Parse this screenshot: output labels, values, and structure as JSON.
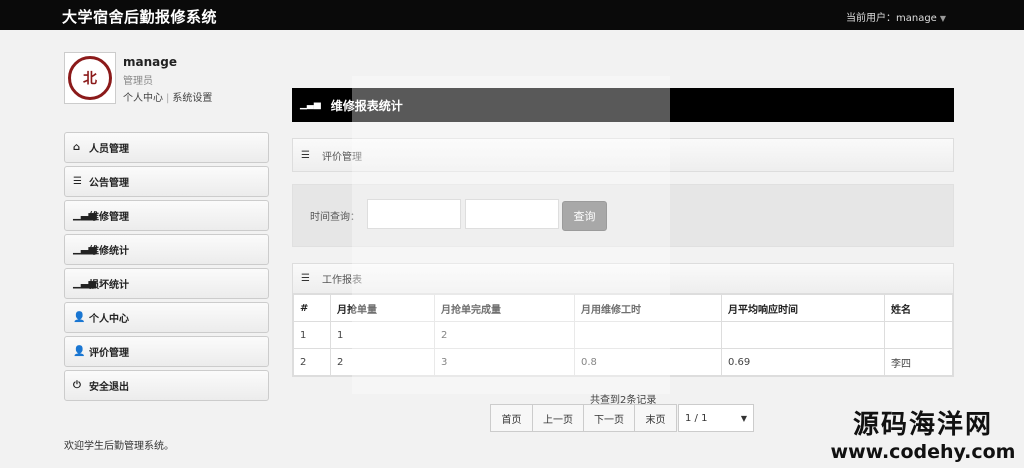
{
  "app": {
    "title": "大学宿舍后勤报修系统",
    "current_user_label": "当前用户：manage"
  },
  "profile": {
    "username": "manage",
    "role": "管理员",
    "link_center": "个人中心",
    "link_settings": "系统设置",
    "avatar_icon": "university-seal-icon"
  },
  "sidebar": {
    "items": [
      {
        "label": "人员管理",
        "icon": "home-icon"
      },
      {
        "label": "公告管理",
        "icon": "list-icon"
      },
      {
        "label": "维修管理",
        "icon": "signal-icon"
      },
      {
        "label": "维修统计",
        "icon": "signal-icon"
      },
      {
        "label": "损坏统计",
        "icon": "signal-icon"
      },
      {
        "label": "个人中心",
        "icon": "user-icon"
      },
      {
        "label": "评价管理",
        "icon": "user-icon"
      },
      {
        "label": "安全退出",
        "icon": "power-icon"
      }
    ],
    "welcome": "欢迎学生后勤管理系统。"
  },
  "main": {
    "panel_title": "维修报表统计",
    "eval_panel_title": "评价管理",
    "query": {
      "label": "时间查询：",
      "start_value": "",
      "end_value": "",
      "button": "查询"
    },
    "report": {
      "title": "工作报表",
      "columns": [
        "#",
        "月抢单量",
        "月抢单完成量",
        "月用维修工时",
        "月平均响应时间",
        "姓名"
      ],
      "rows": [
        [
          "1",
          "1",
          "2",
          "",
          "",
          ""
        ],
        [
          "2",
          "2",
          "3",
          "0.8",
          "0.69",
          "李四"
        ]
      ]
    },
    "pager": {
      "count": "共查到2条记录",
      "first": "首页",
      "prev": "上一页",
      "next": "下一页",
      "last": "末页",
      "page_select": "1 / 1"
    }
  },
  "watermark": {
    "cn": "源码海洋网",
    "url": "www.codehy.com"
  }
}
